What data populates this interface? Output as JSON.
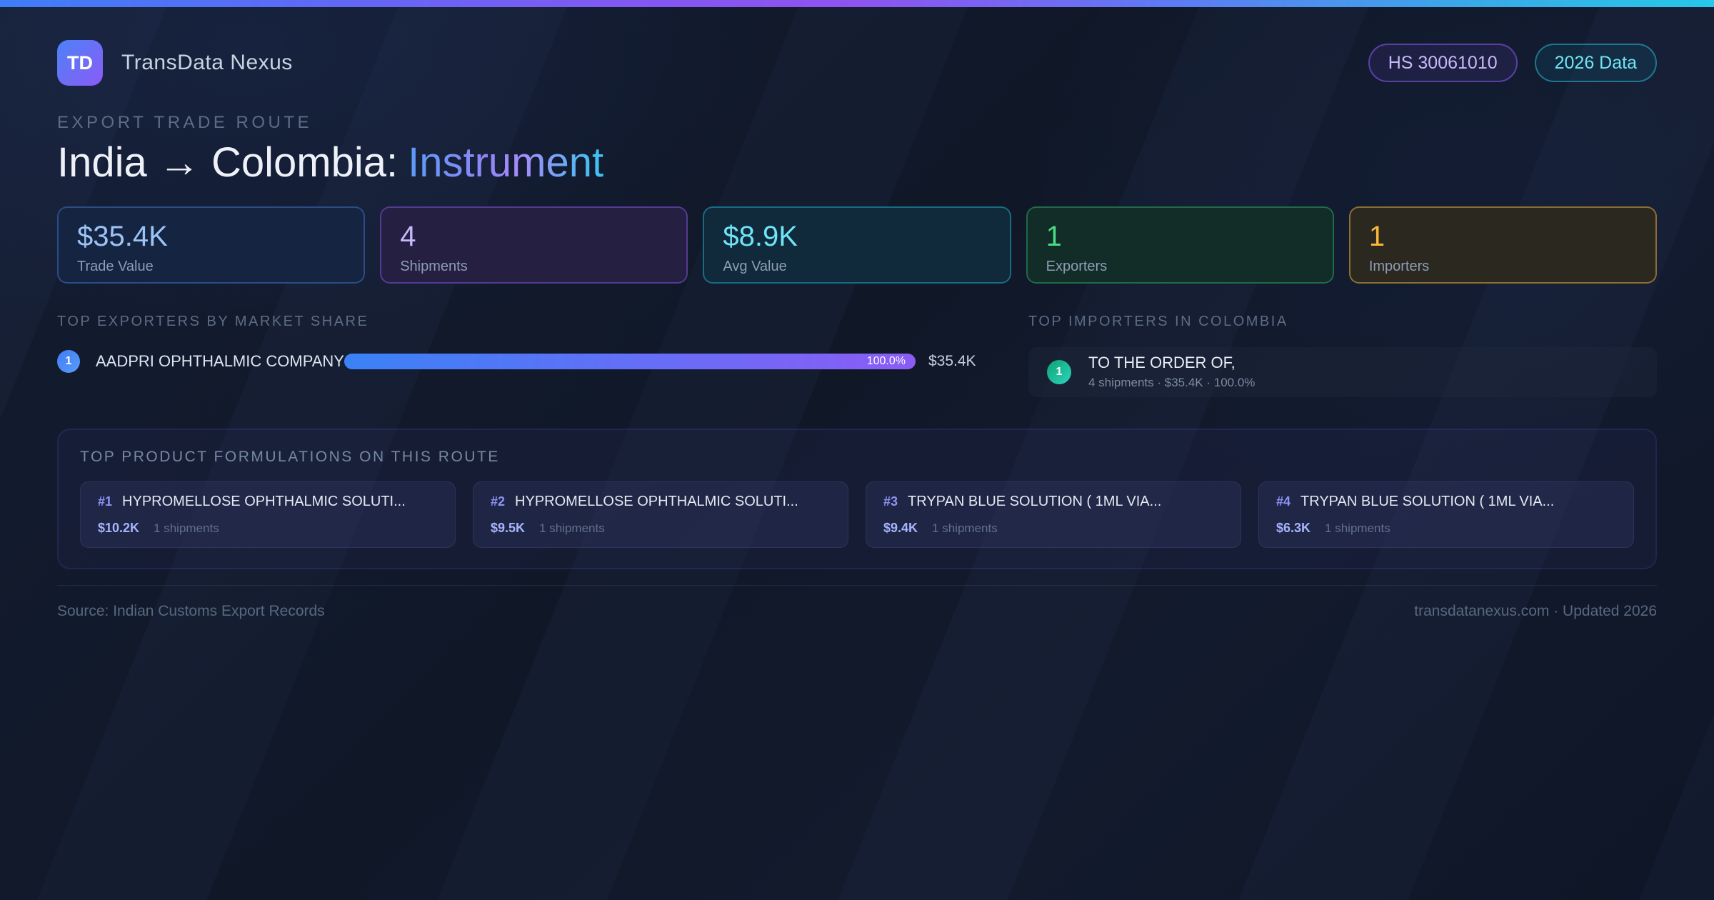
{
  "header": {
    "logo_text": "TD",
    "app_name": "TransData Nexus",
    "badges": [
      {
        "label": "HS 30061010",
        "theme": "purple"
      },
      {
        "label": "2026 Data",
        "theme": "cyan"
      }
    ]
  },
  "hero": {
    "eyebrow": "EXPORT TRADE ROUTE",
    "title_prefix": "India → Colombia:",
    "title_highlight": "Instrument"
  },
  "stats": [
    {
      "value": "$35.4K",
      "label": "Trade Value",
      "theme": "blue"
    },
    {
      "value": "4",
      "label": "Shipments",
      "theme": "purple"
    },
    {
      "value": "$8.9K",
      "label": "Avg Value",
      "theme": "cyan"
    },
    {
      "value": "1",
      "label": "Exporters",
      "theme": "green"
    },
    {
      "value": "1",
      "label": "Importers",
      "theme": "amber"
    }
  ],
  "exporters": {
    "heading": "TOP EXPORTERS BY MARKET SHARE",
    "rows": [
      {
        "rank": "1",
        "name": "AADPRI OPHTHALMIC COMPANY",
        "share_pct": 100,
        "share_label": "100.0%",
        "value": "$35.4K"
      }
    ]
  },
  "importers": {
    "heading": "TOP IMPORTERS IN COLOMBIA",
    "rows": [
      {
        "rank": "1",
        "name": "TO THE ORDER OF,",
        "detail": "4 shipments · $35.4K · 100.0%"
      }
    ]
  },
  "products": {
    "heading": "TOP PRODUCT FORMULATIONS ON THIS ROUTE",
    "items": [
      {
        "rank": "#1",
        "name": "HYPROMELLOSE OPHTHALMIC SOLUTI...",
        "value": "$10.2K",
        "shipments": "1 shipments"
      },
      {
        "rank": "#2",
        "name": "HYPROMELLOSE OPHTHALMIC SOLUTI...",
        "value": "$9.5K",
        "shipments": "1 shipments"
      },
      {
        "rank": "#3",
        "name": "TRYPAN BLUE SOLUTION ( 1ML VIA...",
        "value": "$9.4K",
        "shipments": "1 shipments"
      },
      {
        "rank": "#4",
        "name": "TRYPAN BLUE SOLUTION ( 1ML VIA...",
        "value": "$6.3K",
        "shipments": "1 shipments"
      }
    ]
  },
  "footer": {
    "source": "Source: Indian Customs Export Records",
    "site": "transdatanexus.com · Updated 2026"
  },
  "colors": {
    "accent_blue": "#3b82f6",
    "accent_purple": "#8b5cf6",
    "accent_cyan": "#22d3ee",
    "accent_green": "#34c77b",
    "accent_amber": "#f8b93b",
    "background": "#101828",
    "text_primary": "#eef2f8",
    "text_muted": "#5d6c85"
  }
}
